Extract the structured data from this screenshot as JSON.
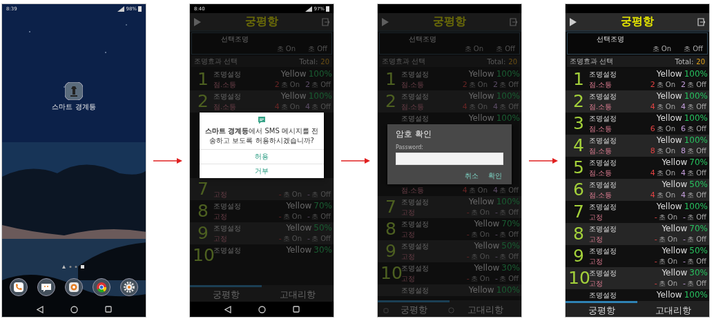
{
  "phones": [
    {
      "kind": "home",
      "status": {
        "time": "8:39",
        "battery": "98%"
      },
      "app": {
        "label": "스마트 경계등"
      }
    },
    {
      "kind": "app",
      "dimmed": true,
      "status": {
        "time": "8:40",
        "battery": "97%"
      },
      "title": "궁평항",
      "header": {
        "label": "선택조명",
        "on": "초 On",
        "off": "초 Off"
      },
      "section": {
        "label": "조명효과 선택",
        "total_label": "Total:",
        "total": "20"
      },
      "items": [
        {
          "kind": "row",
          "number": "1",
          "name": "조명설정",
          "color_name": "Yellow",
          "percent": "100%",
          "mode": "점.소등",
          "on": "2",
          "on_unit": "초 On",
          "off": "2",
          "off_unit": "초 Off"
        },
        {
          "kind": "row",
          "number": "2",
          "name": "조명설정",
          "color_name": "Yellow",
          "percent": "100%",
          "mode": "점.소등",
          "on": "4",
          "on_unit": "초 On",
          "off": "4",
          "off_unit": "초 Off"
        },
        {
          "kind": "sms_dialog",
          "message": "**스마트 경계등**에서 SMS 메시지를 전송하고 보도록 허용하시겠습니까?",
          "buttons": [
            "허용",
            "거부"
          ]
        },
        {
          "kind": "row",
          "number": "7",
          "mode": "고정",
          "on": "-",
          "on_unit": "초 On",
          "off": "-",
          "off_unit": "초 Off"
        },
        {
          "kind": "row",
          "number": "8",
          "name": "조명설정",
          "color_name": "Yellow",
          "percent": "70%",
          "mode": "고정",
          "on": "-",
          "on_unit": "초 On",
          "off": "-",
          "off_unit": "초 Off"
        },
        {
          "kind": "row",
          "number": "9",
          "name": "조명설정",
          "color_name": "Yellow",
          "percent": "50%",
          "mode": "고정",
          "on": "-",
          "on_unit": "초 On",
          "off": "-",
          "off_unit": "초 Off"
        },
        {
          "kind": "row",
          "number": "10",
          "name": "조명설정",
          "color_name": "Yellow",
          "percent": "30%"
        }
      ],
      "tabs": [
        {
          "label": "궁평항",
          "selected": true
        },
        {
          "label": "고대리항",
          "selected": false
        }
      ],
      "nav_bar": {
        "kind": "bar"
      }
    },
    {
      "kind": "app",
      "dimmed": true,
      "title": "궁평항",
      "header": {
        "label": "선택조명",
        "on": "초 On",
        "off": "초 Off"
      },
      "section": {
        "label": "조명효과 선택",
        "total_label": "Total:",
        "total": "20"
      },
      "items": [
        {
          "kind": "row",
          "number": "1",
          "name": "조명설정",
          "color_name": "Yellow",
          "percent": "100%",
          "mode": "점.소등",
          "on": "2",
          "on_unit": "초 On",
          "off": "2",
          "off_unit": "초 Off"
        },
        {
          "kind": "row",
          "number": "2",
          "name": "조명설정",
          "color_name": "Yellow",
          "percent": "100%",
          "mode": "점.소등",
          "on": "4",
          "on_unit": "초 On",
          "off": "4",
          "off_unit": "초 Off"
        },
        {
          "kind": "row",
          "name": "조명설정",
          "color_name": "Yellow",
          "percent": "100%"
        },
        {
          "kind": "password_dialog",
          "title": "암호 확인",
          "field_label": "Password:",
          "buttons": [
            "취소",
            "확인"
          ]
        },
        {
          "kind": "row",
          "mode": "점.소등",
          "on": "4",
          "on_unit": "초 On",
          "off": "4",
          "off_unit": "초 Off"
        },
        {
          "kind": "row",
          "number": "7",
          "name": "조명설정",
          "color_name": "Yellow",
          "percent": "100%",
          "mode": "고정",
          "on": "-",
          "on_unit": "초 On",
          "off": "-",
          "off_unit": "초 Off"
        },
        {
          "kind": "row",
          "number": "8",
          "name": "조명설정",
          "color_name": "Yellow",
          "percent": "70%",
          "mode": "고정",
          "on": "-",
          "on_unit": "초 On",
          "off": "-",
          "off_unit": "초 Off"
        },
        {
          "kind": "row",
          "number": "9",
          "name": "조명설정",
          "color_name": "Yellow",
          "percent": "50%",
          "mode": "고정",
          "on": "-",
          "on_unit": "초 On",
          "off": "-",
          "off_unit": "초 Off"
        },
        {
          "kind": "row",
          "number": "10",
          "name": "조명설정",
          "color_name": "Yellow",
          "percent": "30%",
          "mode": "고정",
          "on": "-",
          "on_unit": "초 On",
          "off": "-",
          "off_unit": "초 Off"
        },
        {
          "kind": "row",
          "name": "조명설정",
          "color_name": "Yellow",
          "percent": "100%"
        }
      ],
      "tabs": [
        {
          "label": "궁평항",
          "selected": true
        },
        {
          "label": "고대리항",
          "selected": false
        }
      ],
      "nav_bar": {
        "kind": "overlay"
      }
    },
    {
      "kind": "app",
      "dimmed": false,
      "title": "궁평항",
      "header": {
        "label": "선택조명",
        "on": "초 On",
        "off": "초 Off"
      },
      "section": {
        "label": "조명효과 선택",
        "total_label": "Total:",
        "total": "20"
      },
      "items": [
        {
          "kind": "row",
          "number": "1",
          "name": "조명설정",
          "color_name": "Yellow",
          "percent": "100%",
          "mode": "점.소등",
          "on": "2",
          "on_unit": "초 On",
          "off": "2",
          "off_unit": "초 Off"
        },
        {
          "kind": "row",
          "number": "2",
          "name": "조명설정",
          "color_name": "Yellow",
          "percent": "100%",
          "mode": "점.소등",
          "on": "4",
          "on_unit": "초 On",
          "off": "4",
          "off_unit": "초 Off"
        },
        {
          "kind": "row",
          "number": "3",
          "name": "조명설정",
          "color_name": "Yellow",
          "percent": "100%",
          "mode": "점.소등",
          "on": "6",
          "on_unit": "초 On",
          "off": "6",
          "off_unit": "초 Off"
        },
        {
          "kind": "row",
          "number": "4",
          "name": "조명설정",
          "color_name": "Yellow",
          "percent": "100%",
          "mode": "점.소등",
          "on": "8",
          "on_unit": "초 On",
          "off": "8",
          "off_unit": "초 Off"
        },
        {
          "kind": "row",
          "number": "5",
          "name": "조명설정",
          "color_name": "Yellow",
          "percent": "70%",
          "mode": "점.소등",
          "on": "4",
          "on_unit": "초 On",
          "off": "4",
          "off_unit": "초 Off"
        },
        {
          "kind": "row",
          "number": "6",
          "name": "조명설정",
          "color_name": "Yellow",
          "percent": "50%",
          "mode": "점.소등",
          "on": "4",
          "on_unit": "초 On",
          "off": "4",
          "off_unit": "초 Off"
        },
        {
          "kind": "row",
          "number": "7",
          "name": "조명설정",
          "color_name": "Yellow",
          "percent": "100%",
          "mode": "고정",
          "on": "-",
          "on_unit": "초 On",
          "off": "-",
          "off_unit": "초 Off"
        },
        {
          "kind": "row",
          "number": "8",
          "name": "조명설정",
          "color_name": "Yellow",
          "percent": "70%",
          "mode": "고정",
          "on": "-",
          "on_unit": "초 On",
          "off": "-",
          "off_unit": "초 Off"
        },
        {
          "kind": "row",
          "number": "9",
          "name": "조명설정",
          "color_name": "Yellow",
          "percent": "50%",
          "mode": "고정",
          "on": "-",
          "on_unit": "초 On",
          "off": "-",
          "off_unit": "초 Off"
        },
        {
          "kind": "row",
          "number": "10",
          "name": "조명설정",
          "color_name": "Yellow",
          "percent": "30%",
          "mode": "고정",
          "on": "-",
          "on_unit": "초 On",
          "off": "-",
          "off_unit": "초 Off"
        },
        {
          "kind": "row",
          "name": "조명설정",
          "color_name": "Yellow",
          "percent": "100%"
        }
      ],
      "tabs": [
        {
          "label": "궁평항",
          "selected": true
        },
        {
          "label": "고대리항",
          "selected": false
        }
      ]
    }
  ]
}
